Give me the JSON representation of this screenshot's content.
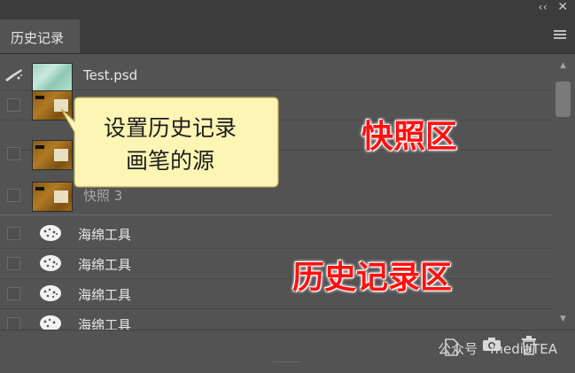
{
  "panel": {
    "tab_title": "历史记录",
    "collapse_glyph": "‹‹",
    "close_glyph": "✕"
  },
  "snapshots": [
    {
      "label": "Test.psd",
      "thumb": "teal",
      "state": "source"
    },
    {
      "label": "",
      "thumb": "gold"
    },
    {
      "label": "",
      "thumb": "gold"
    },
    {
      "label": "快照 3",
      "thumb": "gold"
    }
  ],
  "history": [
    {
      "label": "海绵工具",
      "icon": "sponge-icon"
    },
    {
      "label": "海绵工具",
      "icon": "sponge-icon"
    },
    {
      "label": "海绵工具",
      "icon": "sponge-icon"
    },
    {
      "label": "海绵工具",
      "icon": "sponge-icon"
    }
  ],
  "annotations": {
    "callout_line1": "设置历史记录",
    "callout_line2": "画笔的源",
    "snapshot_area": "快照区",
    "history_area": "历史记录区"
  },
  "watermark": "公众号 · mediaTEA",
  "colors": {
    "panel_bg": "#535353",
    "callout_bg": "#fdf5b4",
    "annotation_red": "#ff1010"
  }
}
